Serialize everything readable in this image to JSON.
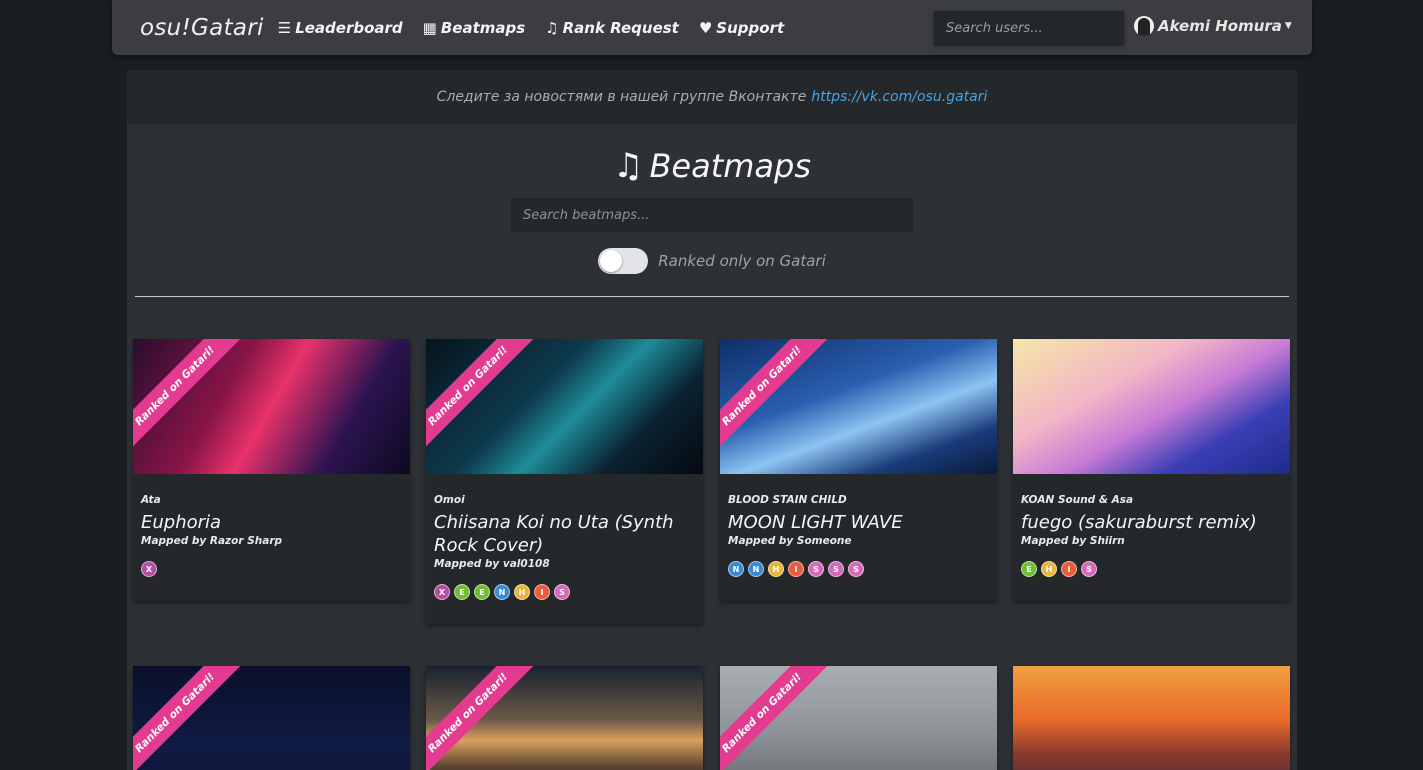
{
  "nav": {
    "brand": "osu!Gatari",
    "items": [
      {
        "label": "Leaderboard",
        "icon": "list-icon"
      },
      {
        "label": "Beatmaps",
        "icon": "grid-icon"
      },
      {
        "label": "Rank Request",
        "icon": "music-note-icon"
      },
      {
        "label": "Support",
        "icon": "heart-icon"
      }
    ],
    "user_search_placeholder": "Search users...",
    "username": "Akemi Homura"
  },
  "notice": {
    "text": "Следите за новостями в нашей группе Вконтакте",
    "link": "https://vk.com/osu.gatari"
  },
  "page": {
    "title": "Beatmaps",
    "search_placeholder": "Search beatmaps...",
    "toggle_label": "Ranked only on Gatari",
    "toggle_on": false
  },
  "colors": {
    "ribbon": "#e23b8f",
    "link": "#4aa3df",
    "navbar": "#3b3d40",
    "card": "#25282b"
  },
  "cards": [
    {
      "ribbon": "Ranked on Gatari!",
      "artist": "Ata",
      "title": "Euphoria",
      "mapper": "Mapped by Razor Sharp",
      "diffs": [
        "X"
      ]
    },
    {
      "ribbon": "Ranked on Gatari!",
      "artist": "Omoi",
      "title": "Chiisana Koi no Uta (Synth Rock Cover)",
      "mapper": "Mapped by val0108",
      "diffs": [
        "X",
        "E",
        "E",
        "N",
        "H",
        "I",
        "S"
      ]
    },
    {
      "ribbon": "Ranked on Gatari!",
      "artist": "BLOOD STAIN CHILD",
      "title": "MOON LIGHT WAVE",
      "mapper": "Mapped by Someone",
      "diffs": [
        "N",
        "N",
        "H",
        "I",
        "S",
        "S",
        "S"
      ]
    },
    {
      "ribbon": "",
      "artist": "KOAN Sound & Asa",
      "title": "fuego (sakuraburst remix)",
      "mapper": "Mapped by Shiirn",
      "diffs": [
        "E",
        "H",
        "I",
        "S"
      ]
    },
    {
      "ribbon": "Ranked on Gatari!",
      "artist": "",
      "title": "",
      "mapper": "",
      "diffs": []
    },
    {
      "ribbon": "Ranked on Gatari!",
      "artist": "",
      "title": "",
      "mapper": "",
      "diffs": []
    },
    {
      "ribbon": "Ranked on Gatari!",
      "artist": "",
      "title": "",
      "mapper": "",
      "diffs": []
    },
    {
      "ribbon": "",
      "artist": "",
      "title": "",
      "mapper": "",
      "diffs": []
    }
  ]
}
